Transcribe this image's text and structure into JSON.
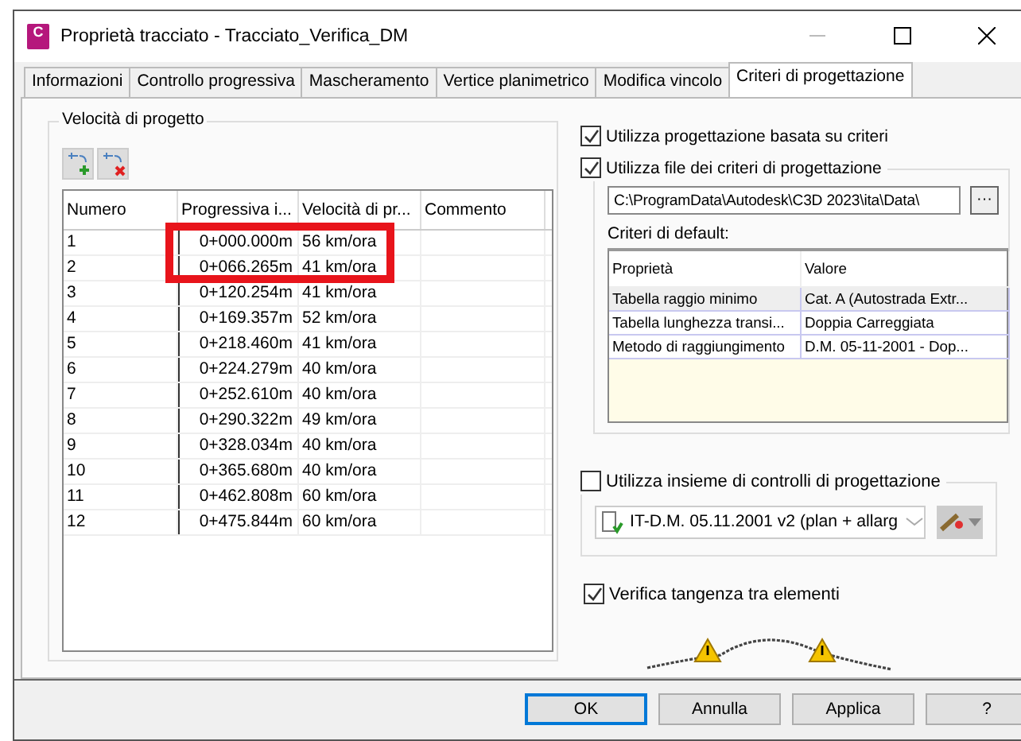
{
  "window": {
    "title": "Proprietà tracciato - Tracciato_Verifica_DM",
    "app_icon_text": "C"
  },
  "tabs": [
    {
      "label": "Informazioni",
      "selected": false
    },
    {
      "label": "Controllo progressiva",
      "selected": false
    },
    {
      "label": "Mascheramento",
      "selected": false
    },
    {
      "label": "Vertice planimetrico",
      "selected": false
    },
    {
      "label": "Modifica vincolo",
      "selected": false
    },
    {
      "label": "Criteri di progettazione",
      "selected": true
    }
  ],
  "speeds": {
    "title": "Velocità di progetto",
    "columns": [
      "Numero",
      "Progressiva i...",
      "Velocità di pr...",
      "Commento"
    ],
    "rows": [
      {
        "cells": [
          "1",
          "0+000.000m",
          "56 km/ora",
          ""
        ]
      },
      {
        "cells": [
          "2",
          "0+066.265m",
          "41 km/ora",
          ""
        ]
      },
      {
        "cells": [
          "3",
          "0+120.254m",
          "41 km/ora",
          ""
        ]
      },
      {
        "cells": [
          "4",
          "0+169.357m",
          "52 km/ora",
          ""
        ]
      },
      {
        "cells": [
          "5",
          "0+218.460m",
          "41 km/ora",
          ""
        ]
      },
      {
        "cells": [
          "6",
          "0+224.279m",
          "40 km/ora",
          ""
        ]
      },
      {
        "cells": [
          "7",
          "0+252.610m",
          "40 km/ora",
          ""
        ]
      },
      {
        "cells": [
          "8",
          "0+290.322m",
          "49 km/ora",
          ""
        ]
      },
      {
        "cells": [
          "9",
          "0+328.034m",
          "40 km/ora",
          ""
        ]
      },
      {
        "cells": [
          "10",
          "0+365.680m",
          "40 km/ora",
          ""
        ]
      },
      {
        "cells": [
          "11",
          "0+462.808m",
          "60 km/ora",
          ""
        ]
      },
      {
        "cells": [
          "12",
          "0+475.844m",
          "60 km/ora",
          ""
        ]
      }
    ]
  },
  "criteria": {
    "use_criteria": {
      "label": "Utilizza progettazione basata su criteri",
      "checked": true
    },
    "use_file": {
      "label": "Utilizza file dei criteri di progettazione",
      "checked": true
    },
    "file_path": "C:\\ProgramData\\Autodesk\\C3D 2023\\ita\\Data\\",
    "browse_label": "···",
    "defaults_label": "Criteri di default:",
    "columns": [
      "Proprietà",
      "Valore"
    ],
    "rows": [
      {
        "property": "Tabella raggio minimo",
        "value": "Cat. A (Autostrada Extr...",
        "selected": true
      },
      {
        "property": "Tabella lunghezza transi...",
        "value": "Doppia Carreggiata",
        "selected": false
      },
      {
        "property": "Metodo di raggiungimento",
        "value": "D.M. 05-11-2001 - Dop...",
        "selected": false
      }
    ]
  },
  "checks": {
    "use_checks": {
      "label": "Utilizza insieme di controlli di progettazione",
      "checked": false
    },
    "check_set": "IT-D.M. 05.11.2001 v2 (plan + allarg"
  },
  "tangency": {
    "label": "Verifica tangenza tra elementi",
    "checked": true
  },
  "buttons": [
    {
      "label": "OK",
      "default": true
    },
    {
      "label": "Annulla",
      "default": false
    },
    {
      "label": "Applica",
      "default": false
    },
    {
      "label": "?",
      "default": false
    }
  ]
}
